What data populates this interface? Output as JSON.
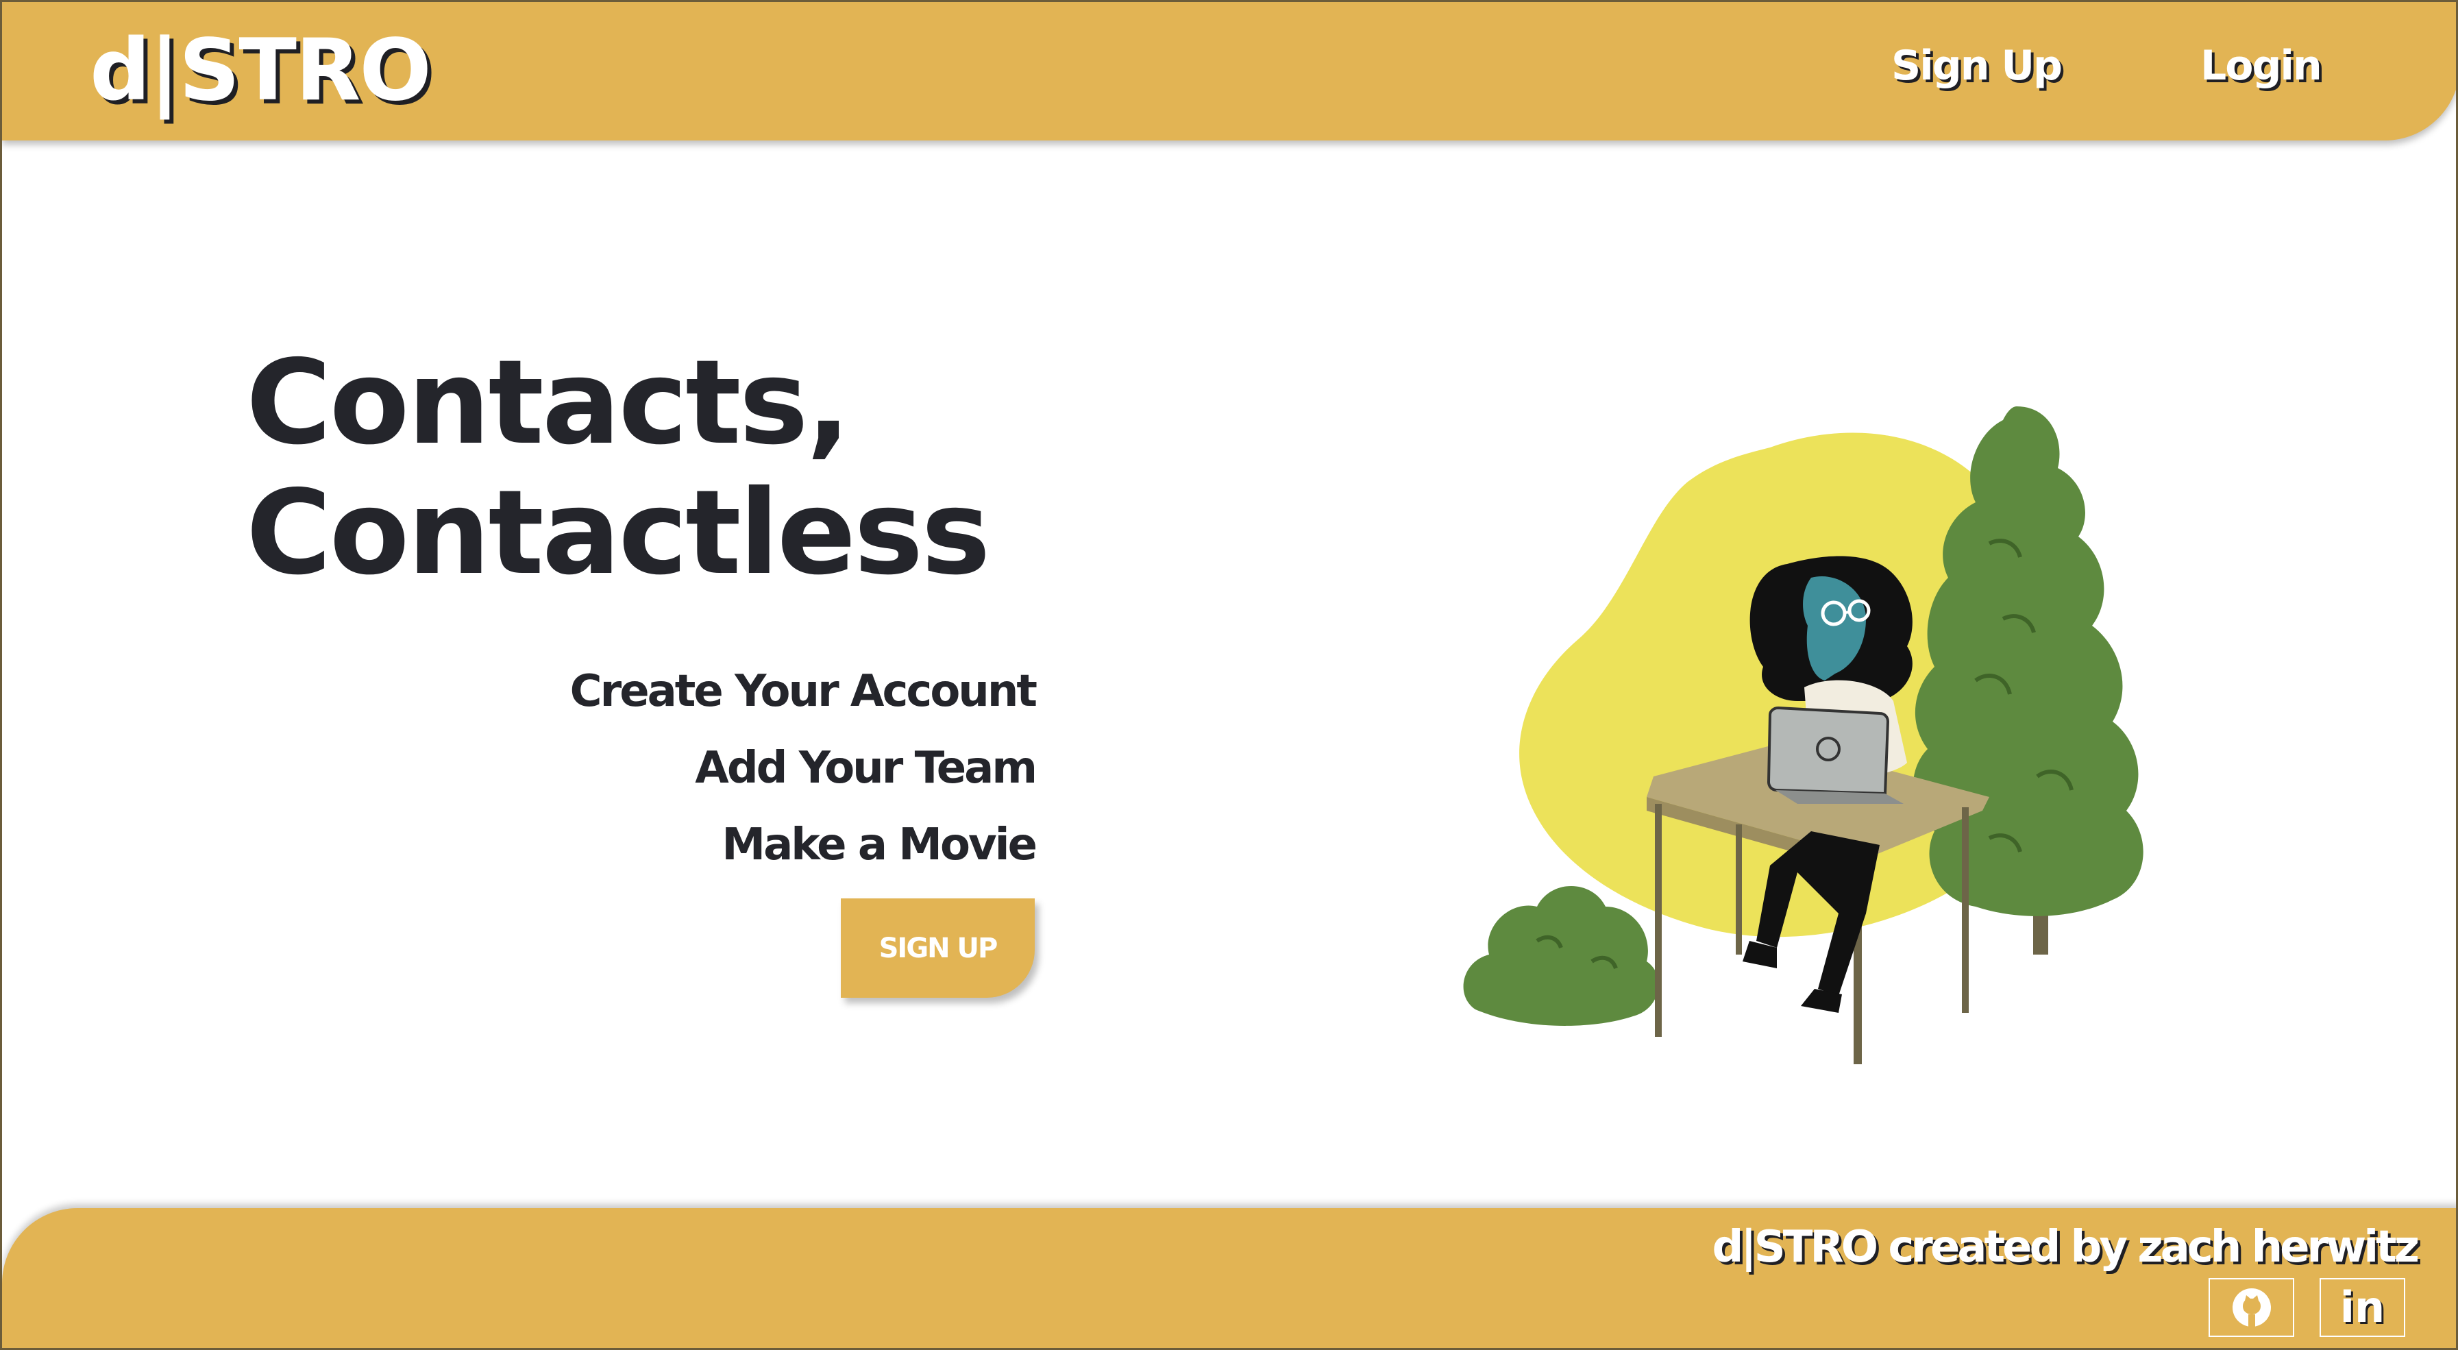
{
  "header": {
    "logo_text": "d|STRO",
    "nav": {
      "signup_label": "Sign Up",
      "login_label": "Login"
    }
  },
  "hero": {
    "title_line1": "Contacts,",
    "title_line2": "Contactless",
    "steps": [
      "Create Your Account",
      "Add Your Team",
      "Make a Movie"
    ],
    "cta_label": "SIGN UP"
  },
  "footer": {
    "credit": "d|STRO created by zach herwitz",
    "linkedin_label": "in",
    "icons": [
      "github-icon",
      "linkedin-icon"
    ]
  },
  "colors": {
    "brand": "#e2b454",
    "text_dark": "#24252b",
    "blob_yellow": "#ece25a",
    "tree_green": "#5e8a3f"
  }
}
